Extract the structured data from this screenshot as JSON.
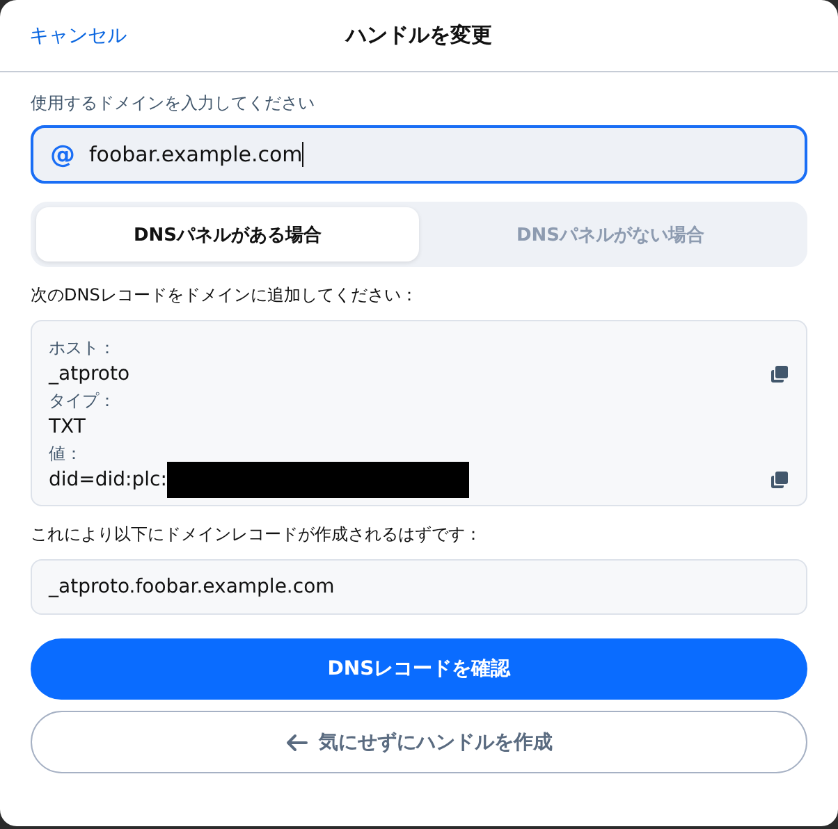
{
  "header": {
    "cancel": "キャンセル",
    "title": "ハンドルを変更"
  },
  "domain_field": {
    "label": "使用するドメインを入力してください",
    "prefix": "@",
    "value": "foobar.example.com"
  },
  "tabs": [
    {
      "label": "DNSパネルがある場合",
      "selected": true
    },
    {
      "label": "DNSパネルがない場合",
      "selected": false
    }
  ],
  "instruction": "次のDNSレコードをドメインに追加してください：",
  "records": [
    {
      "label": "ホスト：",
      "value": "_atproto",
      "copyable": true,
      "redacted": false
    },
    {
      "label": "タイプ：",
      "value": "TXT",
      "copyable": false,
      "redacted": false
    },
    {
      "label": "値：",
      "value": "did=did:plc:",
      "copyable": true,
      "redacted": true
    }
  ],
  "result_label": "これにより以下にドメインレコードが作成されるはずです：",
  "result_value": "_atproto.foobar.example.com",
  "primary_button": "DNSレコードを確認",
  "secondary_button": "気にせずにハンドルを作成"
}
